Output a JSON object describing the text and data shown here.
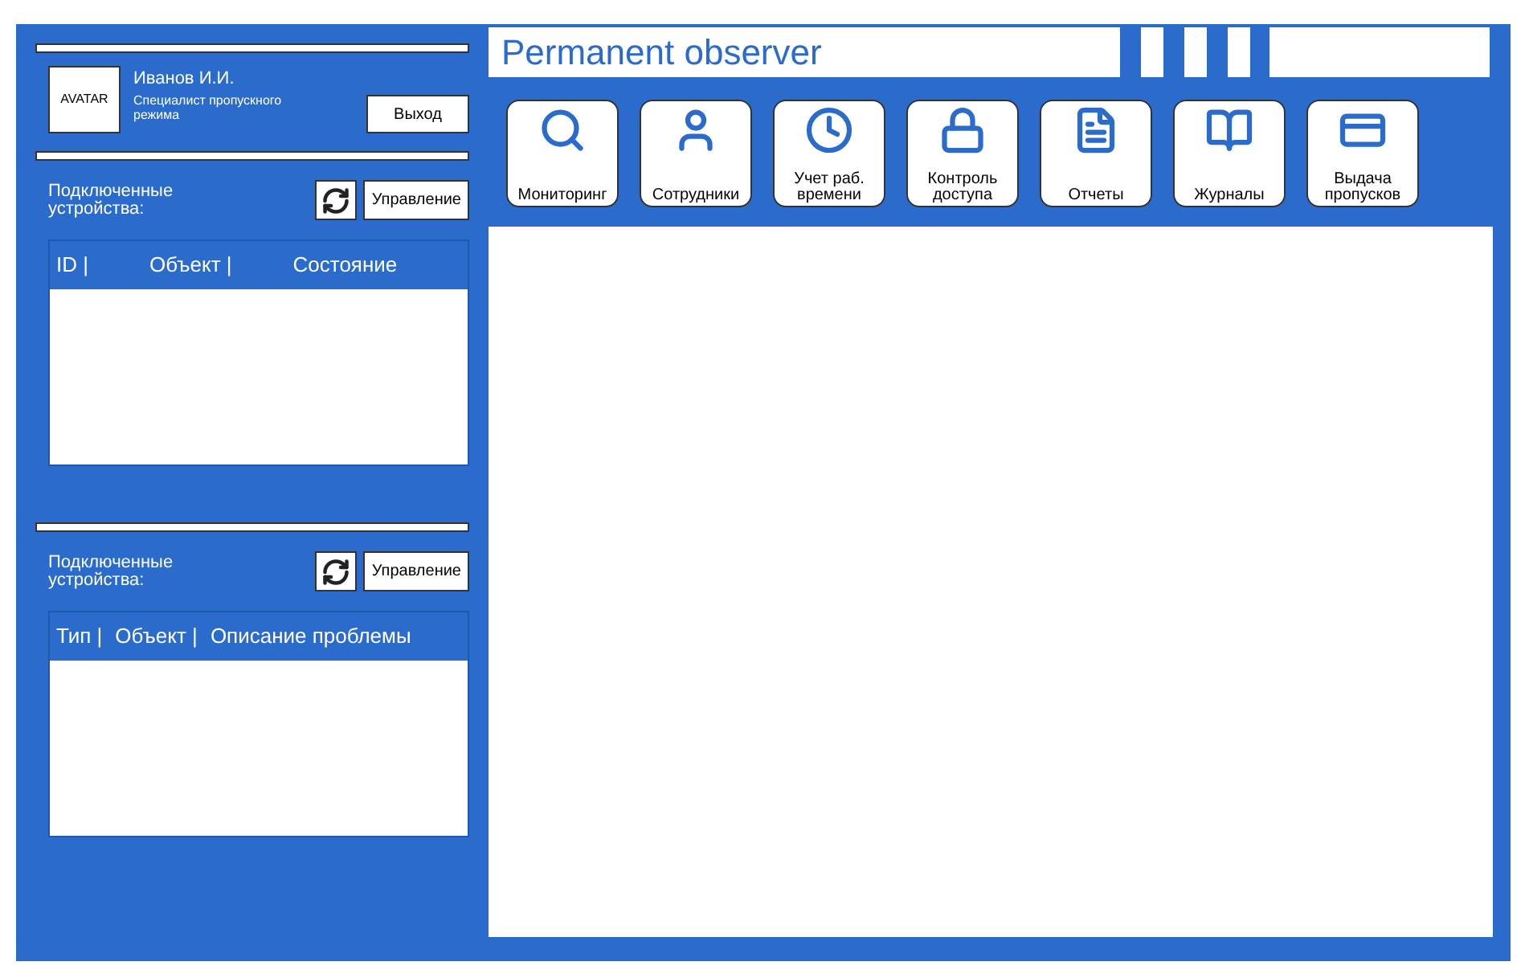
{
  "user": {
    "avatar": "AVATAR",
    "name": "Иванов И.И.",
    "role": "Специалист пропускного режима",
    "logout": "Выход"
  },
  "panels": [
    {
      "label": "Подключенные устройства:",
      "button": "Управление",
      "columns": [
        "ID |",
        "Объект |",
        "Состояние"
      ]
    },
    {
      "label": "Подключенные устройства:",
      "button": "Управление",
      "columns": [
        "Тип |",
        "Объект |",
        "Описание проблемы"
      ]
    }
  ],
  "title": "Permanent observer",
  "nav": [
    "Мониторинг",
    "Сотрудники",
    "Учет раб. времени",
    "Контроль доступа",
    "Отчеты",
    "Журналы",
    "Выдача пропусков"
  ]
}
